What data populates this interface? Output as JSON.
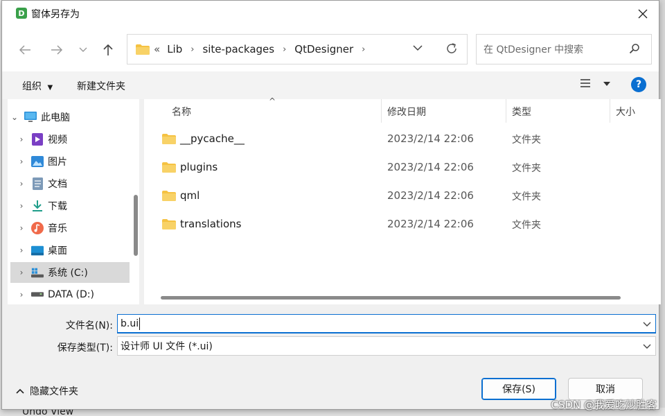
{
  "window": {
    "title": "窗体另存为",
    "app_icon_letter": "D"
  },
  "nav": {
    "breadcrumb_prefix": "«",
    "breadcrumbs": [
      "Lib",
      "site-packages",
      "QtDesigner"
    ],
    "search_placeholder": "在 QtDesigner 中搜索"
  },
  "toolbar": {
    "organize_label": "组织",
    "new_folder_label": "新建文件夹",
    "help_label": "?"
  },
  "tree": {
    "items": [
      {
        "label": "此电脑",
        "icon": "computer-icon"
      },
      {
        "label": "视频",
        "icon": "video-icon"
      },
      {
        "label": "图片",
        "icon": "pictures-icon"
      },
      {
        "label": "文档",
        "icon": "documents-icon"
      },
      {
        "label": "下载",
        "icon": "download-icon"
      },
      {
        "label": "音乐",
        "icon": "music-icon"
      },
      {
        "label": "桌面",
        "icon": "desktop-icon"
      },
      {
        "label": "系统 (C:)",
        "icon": "drive-c-icon",
        "selected": true
      },
      {
        "label": "DATA (D:)",
        "icon": "drive-d-icon"
      }
    ]
  },
  "files": {
    "columns": {
      "name": "名称",
      "date": "修改日期",
      "type": "类型",
      "size": "大小"
    },
    "rows": [
      {
        "name": "__pycache__",
        "date": "2023/2/14 22:06",
        "type": "文件夹"
      },
      {
        "name": "plugins",
        "date": "2023/2/14 22:06",
        "type": "文件夹"
      },
      {
        "name": "qml",
        "date": "2023/2/14 22:06",
        "type": "文件夹"
      },
      {
        "name": "translations",
        "date": "2023/2/14 22:06",
        "type": "文件夹"
      }
    ]
  },
  "form": {
    "filename_label": "文件名(N):",
    "filename_value": "b.ui",
    "filetype_label": "保存类型(T):",
    "filetype_value": "设计师 UI 文件 (*.ui)"
  },
  "footer": {
    "hide_folders_label": "隐藏文件夹",
    "save_label": "保存(S)",
    "cancel_label": "取消"
  },
  "background": {
    "undo_view_label": "Undo View"
  },
  "watermark": "CSDN @我爱吃炒胜客",
  "colors": {
    "accent": "#0a6fd1",
    "folder": "#f5c242",
    "selection": "#d9d9d9"
  }
}
